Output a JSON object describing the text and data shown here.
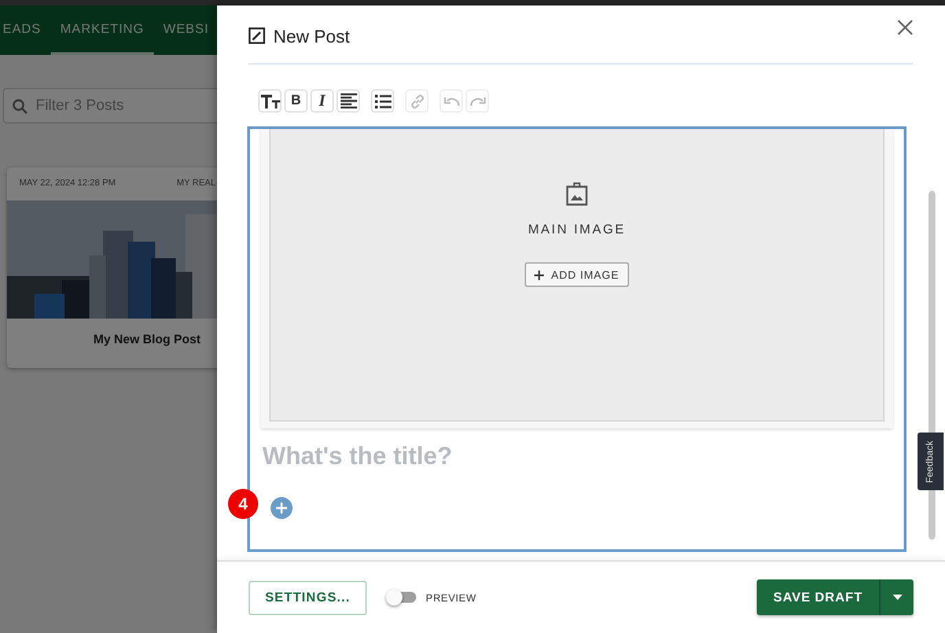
{
  "background": {
    "nav_tabs": [
      {
        "label": "EADS",
        "selected": false
      },
      {
        "label": "MARKETING",
        "selected": true
      },
      {
        "label": "WEBSI",
        "selected": false
      }
    ],
    "search": {
      "placeholder": "Filter 3 Posts"
    },
    "post_card": {
      "date": "MAY 22, 2024 12:28 PM",
      "column_2": "MY REAL",
      "title": "My New Blog Post"
    }
  },
  "dialog": {
    "title": "New Post",
    "toolbar": [
      {
        "kind": "text-size",
        "disabled": false
      },
      {
        "kind": "bold",
        "label": "B",
        "disabled": false
      },
      {
        "kind": "italic",
        "label": "I",
        "disabled": false
      },
      {
        "kind": "align",
        "disabled": false
      },
      {
        "kind": "list",
        "disabled": false
      },
      {
        "kind": "link",
        "disabled": true
      },
      {
        "kind": "undo",
        "disabled": true
      },
      {
        "kind": "redo",
        "disabled": true
      }
    ],
    "main_image": {
      "label": "MAIN IMAGE",
      "button": "ADD IMAGE"
    },
    "title_field": {
      "placeholder": "What's the title?"
    },
    "step_badge": "4",
    "footer": {
      "settings_button": "SETTINGS...",
      "preview": {
        "label": "PREVIEW",
        "on": false
      },
      "save_button": "SAVE DRAFT"
    }
  },
  "feedback_tab": "Feedback"
}
